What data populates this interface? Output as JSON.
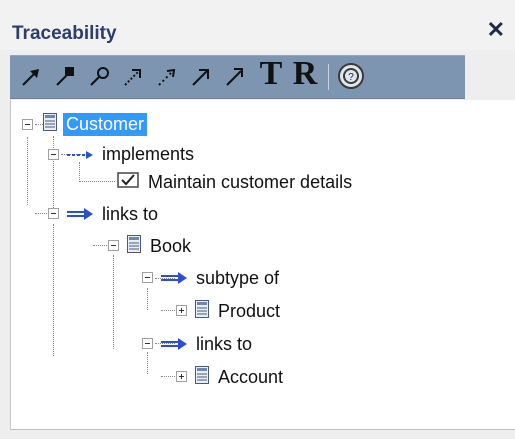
{
  "panel": {
    "title": "Traceability",
    "close_label": "✕"
  },
  "toolbar": {
    "buttons": [
      {
        "name": "link-arrow-icon"
      },
      {
        "name": "link-arrow-filled-icon"
      },
      {
        "name": "find-link-icon"
      },
      {
        "name": "dashed-arrow-icon"
      },
      {
        "name": "dashed-arrow-alt-icon"
      },
      {
        "name": "diagonal-arrow-icon"
      },
      {
        "name": "diagonal-arrow-alt-icon"
      }
    ],
    "t_label": "T",
    "r_label": "R",
    "help_icon": "help-icon"
  },
  "tree": {
    "nodes": [
      {
        "label": "Customer",
        "icon": "class-icon",
        "selected": true
      },
      {
        "label": "implements",
        "icon": "dashed-link-icon"
      },
      {
        "label": "Maintain customer details",
        "icon": "checkbox-icon"
      },
      {
        "label": "links to",
        "icon": "link-icon"
      },
      {
        "label": "Book",
        "icon": "class-icon"
      },
      {
        "label": "subtype of",
        "icon": "link-icon"
      },
      {
        "label": "Product",
        "icon": "class-icon"
      },
      {
        "label": "links to",
        "icon": "link-icon"
      },
      {
        "label": "Account",
        "icon": "class-icon"
      }
    ]
  },
  "colors": {
    "toolbar_bg": "#7d95b0",
    "selected_bg": "#3399ff",
    "title_color": "#2c3d6e"
  }
}
